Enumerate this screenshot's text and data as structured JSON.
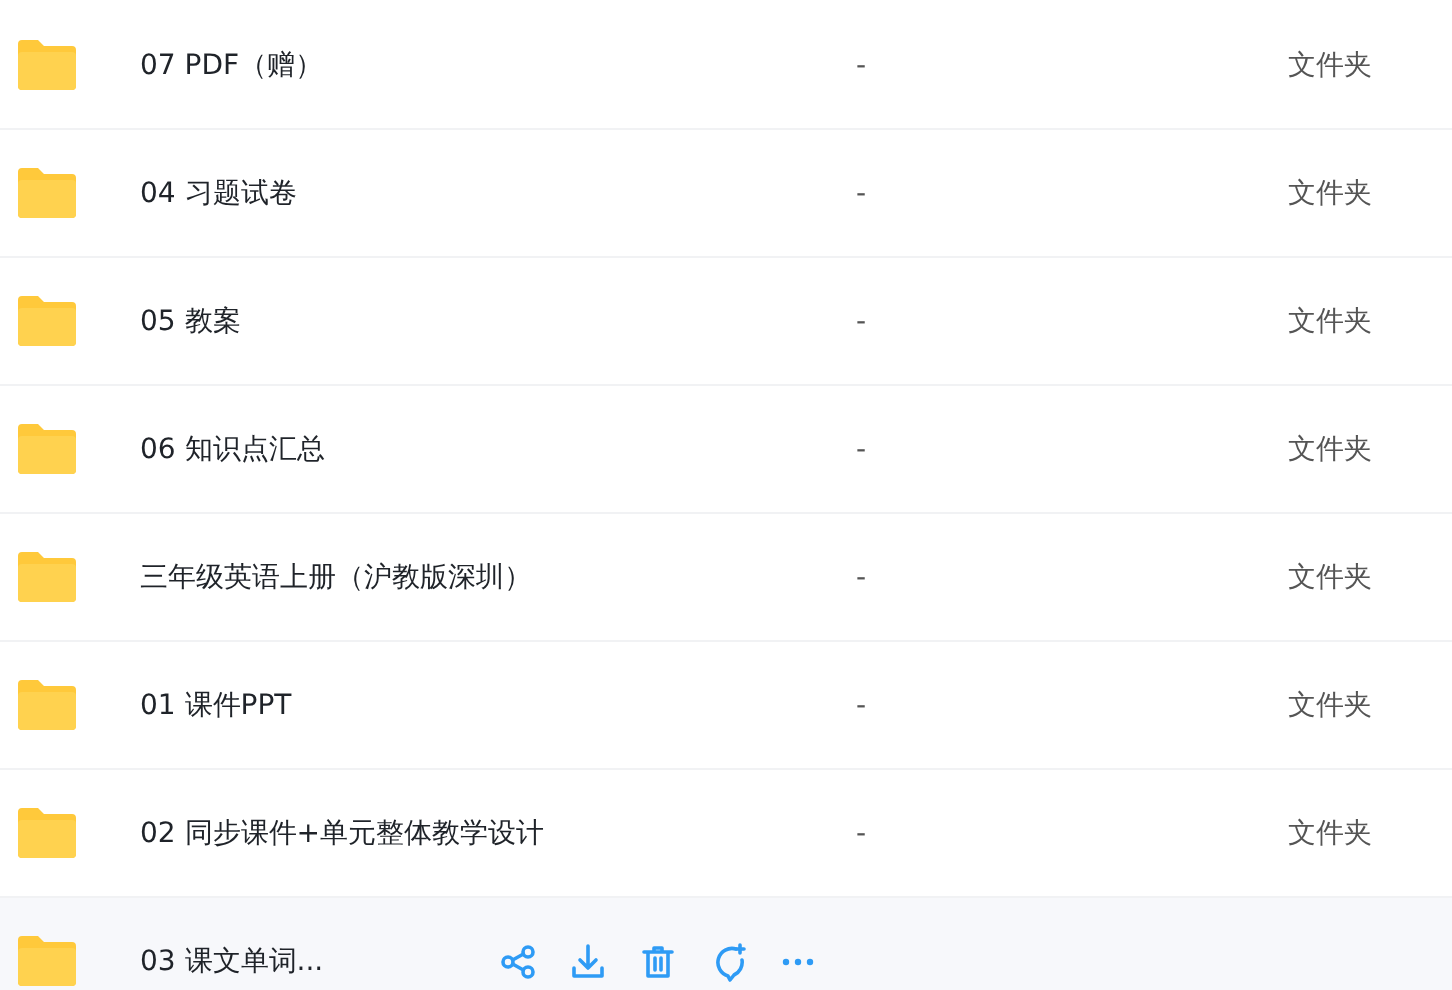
{
  "rows": [
    {
      "name": "07 PDF（赠）",
      "size": "-",
      "type": "文件夹",
      "hovered": false
    },
    {
      "name": "04 习题试卷",
      "size": "-",
      "type": "文件夹",
      "hovered": false
    },
    {
      "name": "05 教案",
      "size": "-",
      "type": "文件夹",
      "hovered": false
    },
    {
      "name": "06 知识点汇总",
      "size": "-",
      "type": "文件夹",
      "hovered": false
    },
    {
      "name": "三年级英语上册（沪教版深圳）",
      "size": "-",
      "type": "文件夹",
      "hovered": false
    },
    {
      "name": "01 课件PPT",
      "size": "-",
      "type": "文件夹",
      "hovered": false
    },
    {
      "name": "02 同步课件+单元整体教学设计",
      "size": "-",
      "type": "文件夹",
      "hovered": false
    },
    {
      "name": "03 课文单词...",
      "hovered": true
    }
  ]
}
